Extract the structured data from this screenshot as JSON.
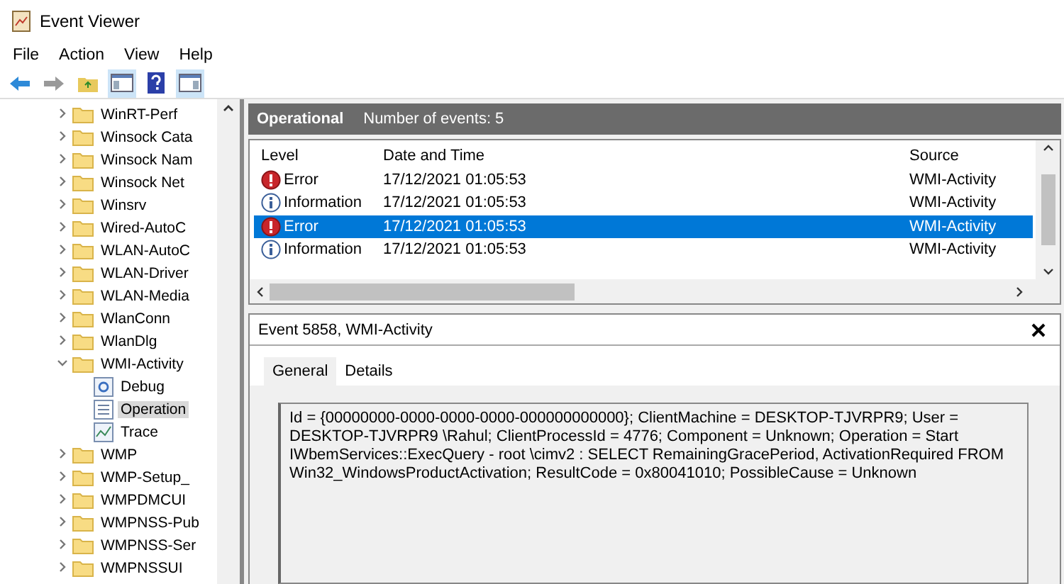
{
  "window": {
    "title": "Event Viewer"
  },
  "menu": [
    "File",
    "Action",
    "View",
    "Help"
  ],
  "tree": [
    {
      "label": "WinRT-Perf",
      "expanded": false
    },
    {
      "label": "Winsock Cata",
      "expanded": false
    },
    {
      "label": "Winsock Nam",
      "expanded": false
    },
    {
      "label": "Winsock Net",
      "expanded": false
    },
    {
      "label": "Winsrv",
      "expanded": false
    },
    {
      "label": "Wired-AutoC",
      "expanded": false
    },
    {
      "label": "WLAN-AutoC",
      "expanded": false
    },
    {
      "label": "WLAN-Driver",
      "expanded": false
    },
    {
      "label": "WLAN-Media",
      "expanded": false
    },
    {
      "label": "WlanConn",
      "expanded": false
    },
    {
      "label": "WlanDlg",
      "expanded": false
    },
    {
      "label": "WMI-Activity",
      "expanded": true,
      "children": [
        {
          "label": "Debug",
          "kind": "debug",
          "selected": false
        },
        {
          "label": "Operation",
          "kind": "operational",
          "selected": true
        },
        {
          "label": "Trace",
          "kind": "trace",
          "selected": false
        }
      ]
    },
    {
      "label": "WMP",
      "expanded": false
    },
    {
      "label": "WMP-Setup_",
      "expanded": false
    },
    {
      "label": "WMPDMCUI",
      "expanded": false
    },
    {
      "label": "WMPNSS-Pub",
      "expanded": false
    },
    {
      "label": "WMPNSS-Ser",
      "expanded": false
    },
    {
      "label": "WMPNSSUI",
      "expanded": false
    }
  ],
  "log_header": {
    "name": "Operational",
    "count": "Number of events: 5"
  },
  "table": {
    "columns": [
      "Level",
      "Date and Time",
      "Source"
    ],
    "rows": [
      {
        "kind": "error",
        "level": "Error",
        "date": "17/12/2021 01:05:53",
        "source": "WMI-Activity",
        "selected": false
      },
      {
        "kind": "information",
        "level": "Information",
        "date": "17/12/2021 01:05:53",
        "source": "WMI-Activity",
        "selected": false
      },
      {
        "kind": "error",
        "level": "Error",
        "date": "17/12/2021 01:05:53",
        "source": "WMI-Activity",
        "selected": true
      },
      {
        "kind": "information",
        "level": "Information",
        "date": "17/12/2021 01:05:53",
        "source": "WMI-Activity",
        "selected": false
      }
    ]
  },
  "details": {
    "title": "Event 5858, WMI-Activity",
    "tabs": [
      {
        "label": "General",
        "selected": true
      },
      {
        "label": "Details",
        "selected": false
      }
    ],
    "text": "Id = {00000000-0000-0000-0000-000000000000}; ClientMachine = DESKTOP-TJVRPR9; User = DESKTOP-TJVRPR9 \\Rahul; ClientProcessId = 4776; Component = Unknown; Operation = Start IWbemServices::ExecQuery - root \\cimv2 : SELECT RemainingGracePeriod, ActivationRequired FROM Win32_WindowsProductActivation; ResultCode = 0x80041010; PossibleCause = Unknown"
  }
}
